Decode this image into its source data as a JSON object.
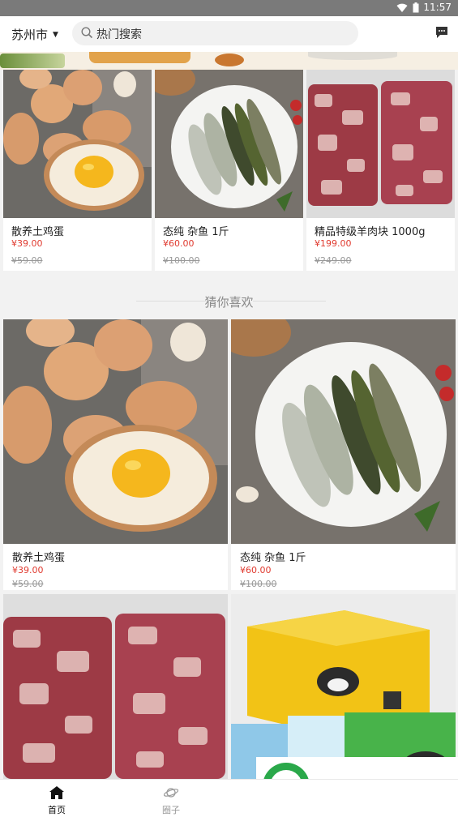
{
  "status_bar": {
    "time": "11:57"
  },
  "header": {
    "city": "苏州市",
    "search_placeholder": "热门搜索"
  },
  "featured": [
    {
      "name": "散养土鸡蛋",
      "price": "¥39.00",
      "original_price": "¥59.00",
      "image": "eggs"
    },
    {
      "name": "态纯 杂鱼 1斤",
      "price": "¥60.00",
      "original_price": "¥100.00",
      "image": "fish"
    },
    {
      "name": "精品特级羊肉块 1000g",
      "price": "¥199.00",
      "original_price": "¥249.00",
      "image": "mutton"
    }
  ],
  "section": {
    "title": "猜你喜欢"
  },
  "recommend": [
    {
      "name": "散养土鸡蛋",
      "price": "¥39.00",
      "original_price": "¥59.00",
      "image": "eggs"
    },
    {
      "name": "态纯 杂鱼 1斤",
      "price": "¥60.00",
      "original_price": "¥100.00",
      "image": "fish"
    },
    {
      "name": "",
      "price": "",
      "original_price": "",
      "image": "mutton"
    },
    {
      "name": "",
      "price": "",
      "original_price": "",
      "image": "boxed-mutton"
    }
  ],
  "tabs": [
    {
      "label": "首页",
      "icon": "home-icon",
      "active": true
    },
    {
      "label": "圈子",
      "icon": "planet-icon",
      "active": false
    }
  ],
  "colors": {
    "price": "#e03a2f",
    "accent_green": "#2aa84a",
    "status_bar": "#7a7a7a"
  }
}
